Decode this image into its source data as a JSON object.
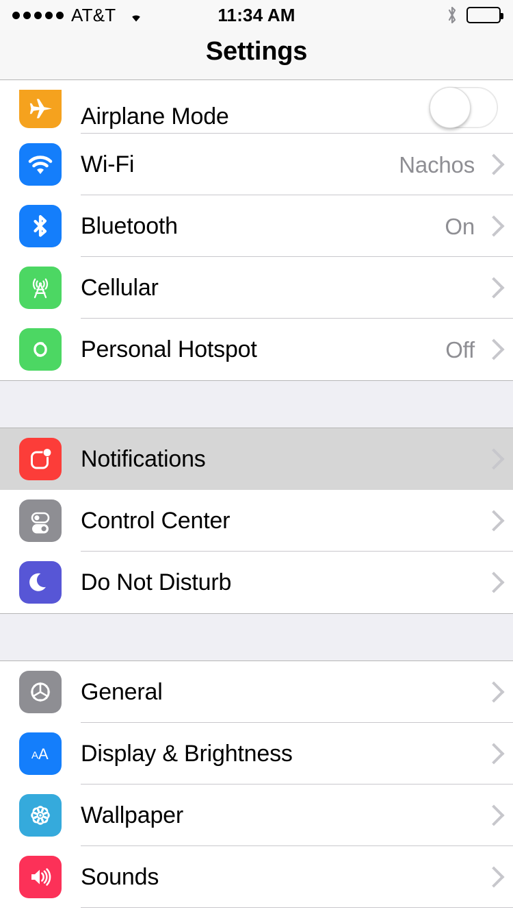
{
  "status_bar": {
    "signal_dots": 5,
    "carrier": "AT&T",
    "wifi_icon": "wifi-icon",
    "time": "11:34 AM",
    "bluetooth_icon": "bluetooth-icon",
    "battery_icon": "battery-full-icon"
  },
  "navbar": {
    "title": "Settings"
  },
  "colors": {
    "airplane": "#f5a21e",
    "wifi": "#147efb",
    "bluetooth": "#147efb",
    "cellular": "#4cd763",
    "hotspot": "#4cd763",
    "notifications": "#fc3d39",
    "control_center": "#8e8e93",
    "do_not_disturb": "#5756d6",
    "general": "#8e8e93",
    "display": "#147efb",
    "wallpaper": "#35aadc",
    "sounds": "#fc3158",
    "detail_text": "#8e8e93",
    "chevron": "#c7c7cc",
    "group_gap": "#efeff4",
    "row_highlight": "#d6d6d6",
    "separator": "#c8c7cc"
  },
  "groups": [
    {
      "id": "connectivity",
      "rows": [
        {
          "id": "airplane-mode",
          "icon": "airplane-icon",
          "label": "Airplane Mode",
          "detail": "",
          "accessory": "toggle",
          "toggle_on": false,
          "clipped": true,
          "highlighted": false
        },
        {
          "id": "wifi",
          "icon": "wifi-icon",
          "label": "Wi-Fi",
          "detail": "Nachos",
          "accessory": "chevron",
          "highlighted": false
        },
        {
          "id": "bluetooth",
          "icon": "bluetooth-icon",
          "label": "Bluetooth",
          "detail": "On",
          "accessory": "chevron",
          "highlighted": false
        },
        {
          "id": "cellular",
          "icon": "cellular-icon",
          "label": "Cellular",
          "detail": "",
          "accessory": "chevron",
          "highlighted": false
        },
        {
          "id": "personal-hotspot",
          "icon": "hotspot-icon",
          "label": "Personal Hotspot",
          "detail": "Off",
          "accessory": "chevron",
          "highlighted": false
        }
      ]
    },
    {
      "id": "notifications-group",
      "rows": [
        {
          "id": "notifications",
          "icon": "notifications-icon",
          "label": "Notifications",
          "detail": "",
          "accessory": "chevron",
          "highlighted": true
        },
        {
          "id": "control-center",
          "icon": "control-center-icon",
          "label": "Control Center",
          "detail": "",
          "accessory": "chevron",
          "highlighted": false
        },
        {
          "id": "do-not-disturb",
          "icon": "moon-icon",
          "label": "Do Not Disturb",
          "detail": "",
          "accessory": "chevron",
          "highlighted": false
        }
      ]
    },
    {
      "id": "system-group",
      "rows": [
        {
          "id": "general",
          "icon": "gear-icon",
          "label": "General",
          "detail": "",
          "accessory": "chevron",
          "highlighted": false
        },
        {
          "id": "display-brightness",
          "icon": "text-size-icon",
          "label": "Display & Brightness",
          "detail": "",
          "accessory": "chevron",
          "highlighted": false
        },
        {
          "id": "wallpaper",
          "icon": "flower-icon",
          "label": "Wallpaper",
          "detail": "",
          "accessory": "chevron",
          "highlighted": false
        },
        {
          "id": "sounds",
          "icon": "speaker-icon",
          "label": "Sounds",
          "detail": "",
          "accessory": "chevron",
          "highlighted": false
        }
      ]
    }
  ]
}
